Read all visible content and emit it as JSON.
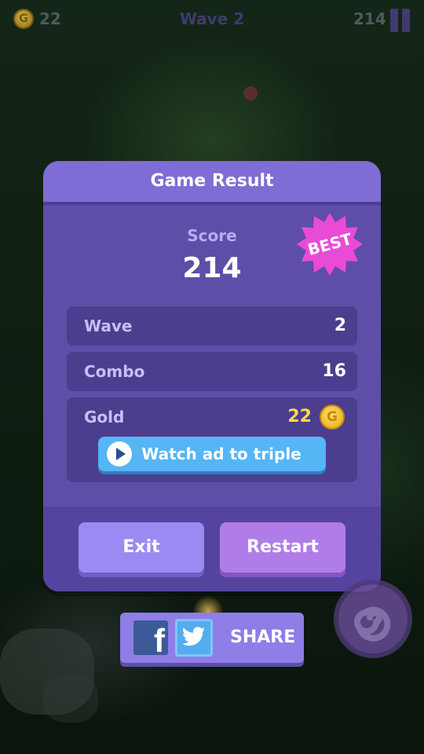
{
  "hud": {
    "coins": "22",
    "coin_symbol": "G",
    "wave": "Wave 2",
    "score": "214"
  },
  "dialog": {
    "title": "Game Result",
    "score_label": "Score",
    "score_value": "214",
    "best_badge": "BEST",
    "rows": [
      {
        "label": "Wave",
        "value": "2"
      },
      {
        "label": "Combo",
        "value": "16"
      },
      {
        "label": "Gold",
        "value": "22"
      }
    ],
    "gold_coin_symbol": "G",
    "watch_ad_label": "Watch ad to triple",
    "exit_label": "Exit",
    "restart_label": "Restart"
  },
  "share": {
    "facebook_glyph": "f",
    "label": "SHARE"
  },
  "colors": {
    "panel": "#5e4ea8",
    "header": "#7e6dd4",
    "accent_blue": "#55b5f5",
    "best_badge": "#e94bd6",
    "gold": "#ffd94a"
  }
}
